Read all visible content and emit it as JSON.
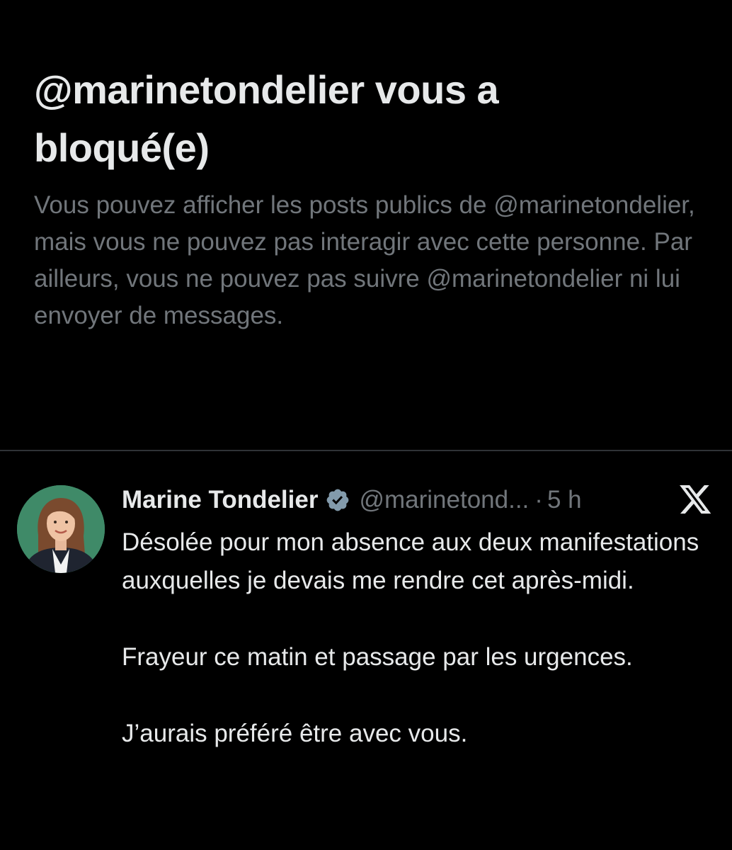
{
  "blocked": {
    "title_line1": "@marinetondelier vous a",
    "title_line2": "bloqué(e)",
    "description": "Vous pouvez afficher les posts publics de @marinetondelier, mais vous ne pouvez pas interagir avec cette personne. Par ailleurs, vous ne pouvez pas suivre @marinetondelier ni lui envoyer de messages."
  },
  "tweet": {
    "display_name": "Marine Tondelier",
    "verified_icon": "verified-badge-icon",
    "handle": "@marinetond...",
    "separator": "·",
    "time": "5 h",
    "platform_icon": "x-logo-icon",
    "paragraphs": [
      "Désolée pour mon absence aux deux manifestations auxquelles je devais me rendre cet après-midi.",
      "Frayeur ce matin et passage par les urgences.",
      "J’aurais préféré être avec vous."
    ]
  },
  "colors": {
    "background": "#000000",
    "primary_text": "#e7e9ea",
    "secondary_text": "#71767b",
    "divider": "#2f3336",
    "avatar_background": "#3f8a68",
    "verified_badge": "#829aab"
  }
}
